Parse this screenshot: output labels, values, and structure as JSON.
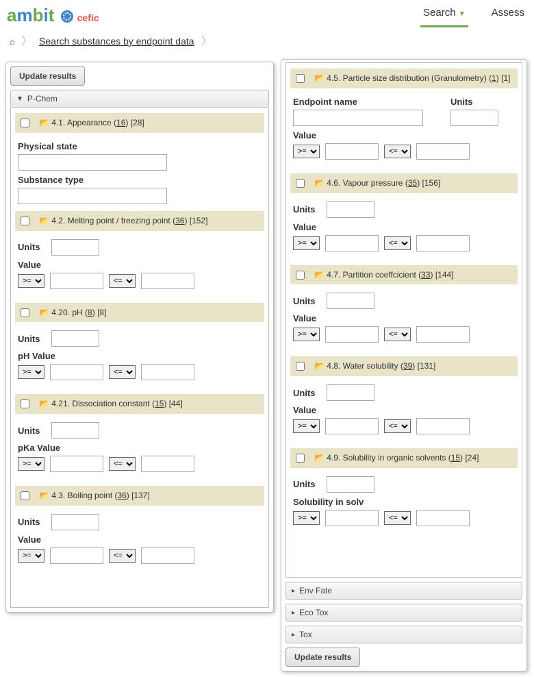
{
  "brand": {
    "cefic": "cefic"
  },
  "nav": {
    "search": "Search",
    "assess": "Assess"
  },
  "breadcrumb": {
    "text": "Search substances by endpoint data"
  },
  "buttons": {
    "update": "Update results"
  },
  "accordion": {
    "pchem": "P-Chem",
    "envfate": "Env Fate",
    "ecotox": "Eco Tox",
    "tox": "Tox"
  },
  "labels": {
    "physical_state": "Physical state",
    "substance_type": "Substance type",
    "units": "Units",
    "value": "Value",
    "ph_value": "pH Value",
    "pka_value": "pKa Value",
    "endpoint_name": "Endpoint name",
    "solubility_solv": "Solubility in solv"
  },
  "ops": {
    "gte": ">=",
    "lte": "<="
  },
  "cats": {
    "c41": {
      "num": "4.1.",
      "name": "Appearance",
      "a": "16",
      "b": "[28]"
    },
    "c42": {
      "num": "4.2.",
      "name": "Melting point / freezing point",
      "a": "36",
      "b": "[152]"
    },
    "c420": {
      "num": "4.20.",
      "name": "pH",
      "a": "8",
      "b": "[8]"
    },
    "c421": {
      "num": "4.21.",
      "name": "Dissociation constant",
      "a": "15",
      "b": "[44]"
    },
    "c43": {
      "num": "4.3.",
      "name": "Boiling point",
      "a": "36",
      "b": "[137]"
    },
    "c45": {
      "num": "4.5.",
      "name": "Particle size distribution (Granulometry)",
      "a": "1",
      "b": "[1]"
    },
    "c46": {
      "num": "4.6.",
      "name": "Vapour pressure",
      "a": "35",
      "b": "[156]"
    },
    "c47": {
      "num": "4.7.",
      "name": "Partition coeffcicient",
      "a": "33",
      "b": "[144]"
    },
    "c48": {
      "num": "4.8.",
      "name": "Water solubility",
      "a": "39",
      "b": "[131]"
    },
    "c49": {
      "num": "4.9.",
      "name": "Solubility in organic solvents",
      "a": "15",
      "b": "[24]"
    }
  }
}
